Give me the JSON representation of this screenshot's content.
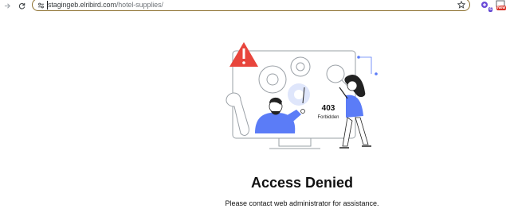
{
  "browser": {
    "url_host": "stagingeb.elribird.com",
    "url_path": "/hotel-supplies/",
    "extensions": {
      "first_badge": "6",
      "second_badge": "New"
    }
  },
  "illustration": {
    "status_code": "403",
    "status_text": "Forbidden"
  },
  "main": {
    "heading": "Access Denied",
    "message": "Please contact web administrator for assistance."
  },
  "colors": {
    "accent_blue": "#5b7cf7",
    "warning_red": "#e8453c",
    "line_gray": "#9aa0a6"
  }
}
